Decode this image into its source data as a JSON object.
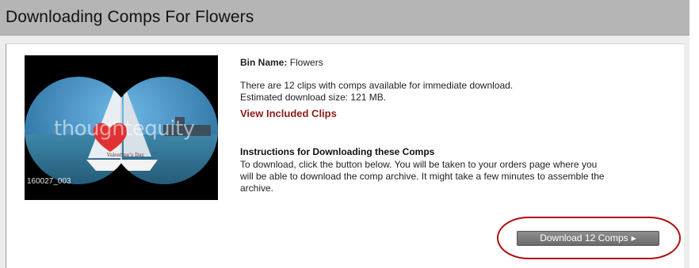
{
  "header": {
    "title": "Downloading Comps For Flowers"
  },
  "thumbnail": {
    "clip_id": "160027_003",
    "watermark": "thoughtequity",
    "caption": "Valentine's Day"
  },
  "bin": {
    "label": "Bin Name:",
    "name": "Flowers"
  },
  "summary": {
    "clips_text": "There are 12 clips with comps available for immediate download.",
    "size_text": "Estimated download size: 121 MB.",
    "view_link": "View Included Clips"
  },
  "instructions": {
    "title": "Instructions for Downloading these Comps",
    "line1": "To download, click the button below. You will be taken to your orders page where you",
    "line2": "will be able to download the comp archive. It might take a few minutes to assemble the",
    "line3": "archive."
  },
  "download_button": {
    "label": "Download 12 Comps",
    "arrow_icon": "triangle-right-icon"
  },
  "colors": {
    "header_bg": "#b5b5b5",
    "link": "#8b1a1a",
    "highlight_oval": "#b10e0e",
    "button_bg": "#7a7a7a"
  }
}
